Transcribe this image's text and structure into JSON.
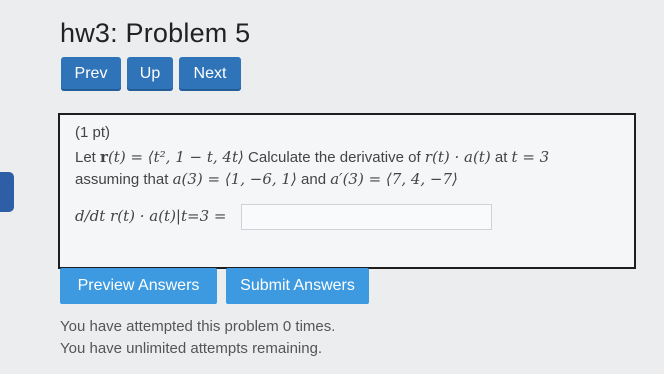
{
  "page": {
    "title": "hw3: Problem 5"
  },
  "nav": {
    "prev": "Prev",
    "up": "Up",
    "next": "Next"
  },
  "problem": {
    "points": "(1 pt)",
    "line1_prefix": "Let",
    "line1_r": "r",
    "line1_def": "(t) = ⟨t², 1 − t, 4t⟩",
    "line1_text": "Calculate the derivative of",
    "line1_expr": "r(t) · a(t)",
    "line1_at": "at",
    "line1_t": "t = 3",
    "line2_prefix": "assuming that",
    "line2_a": "a(3) = ⟨1, −6, 1⟩",
    "line2_and": "and",
    "line2_aprime": "a′(3) = ⟨7, 4, −7⟩",
    "answer_lhs": "d/dt r(t) · a(t)|t=3 =",
    "answer_value": ""
  },
  "actions": {
    "preview": "Preview Answers",
    "submit": "Submit Answers"
  },
  "status": {
    "attempts": "You have attempted this problem 0 times.",
    "remaining": "You have unlimited attempts remaining."
  },
  "colors": {
    "button_dark": "#2f73b9",
    "button_light": "#3d9ae0"
  }
}
